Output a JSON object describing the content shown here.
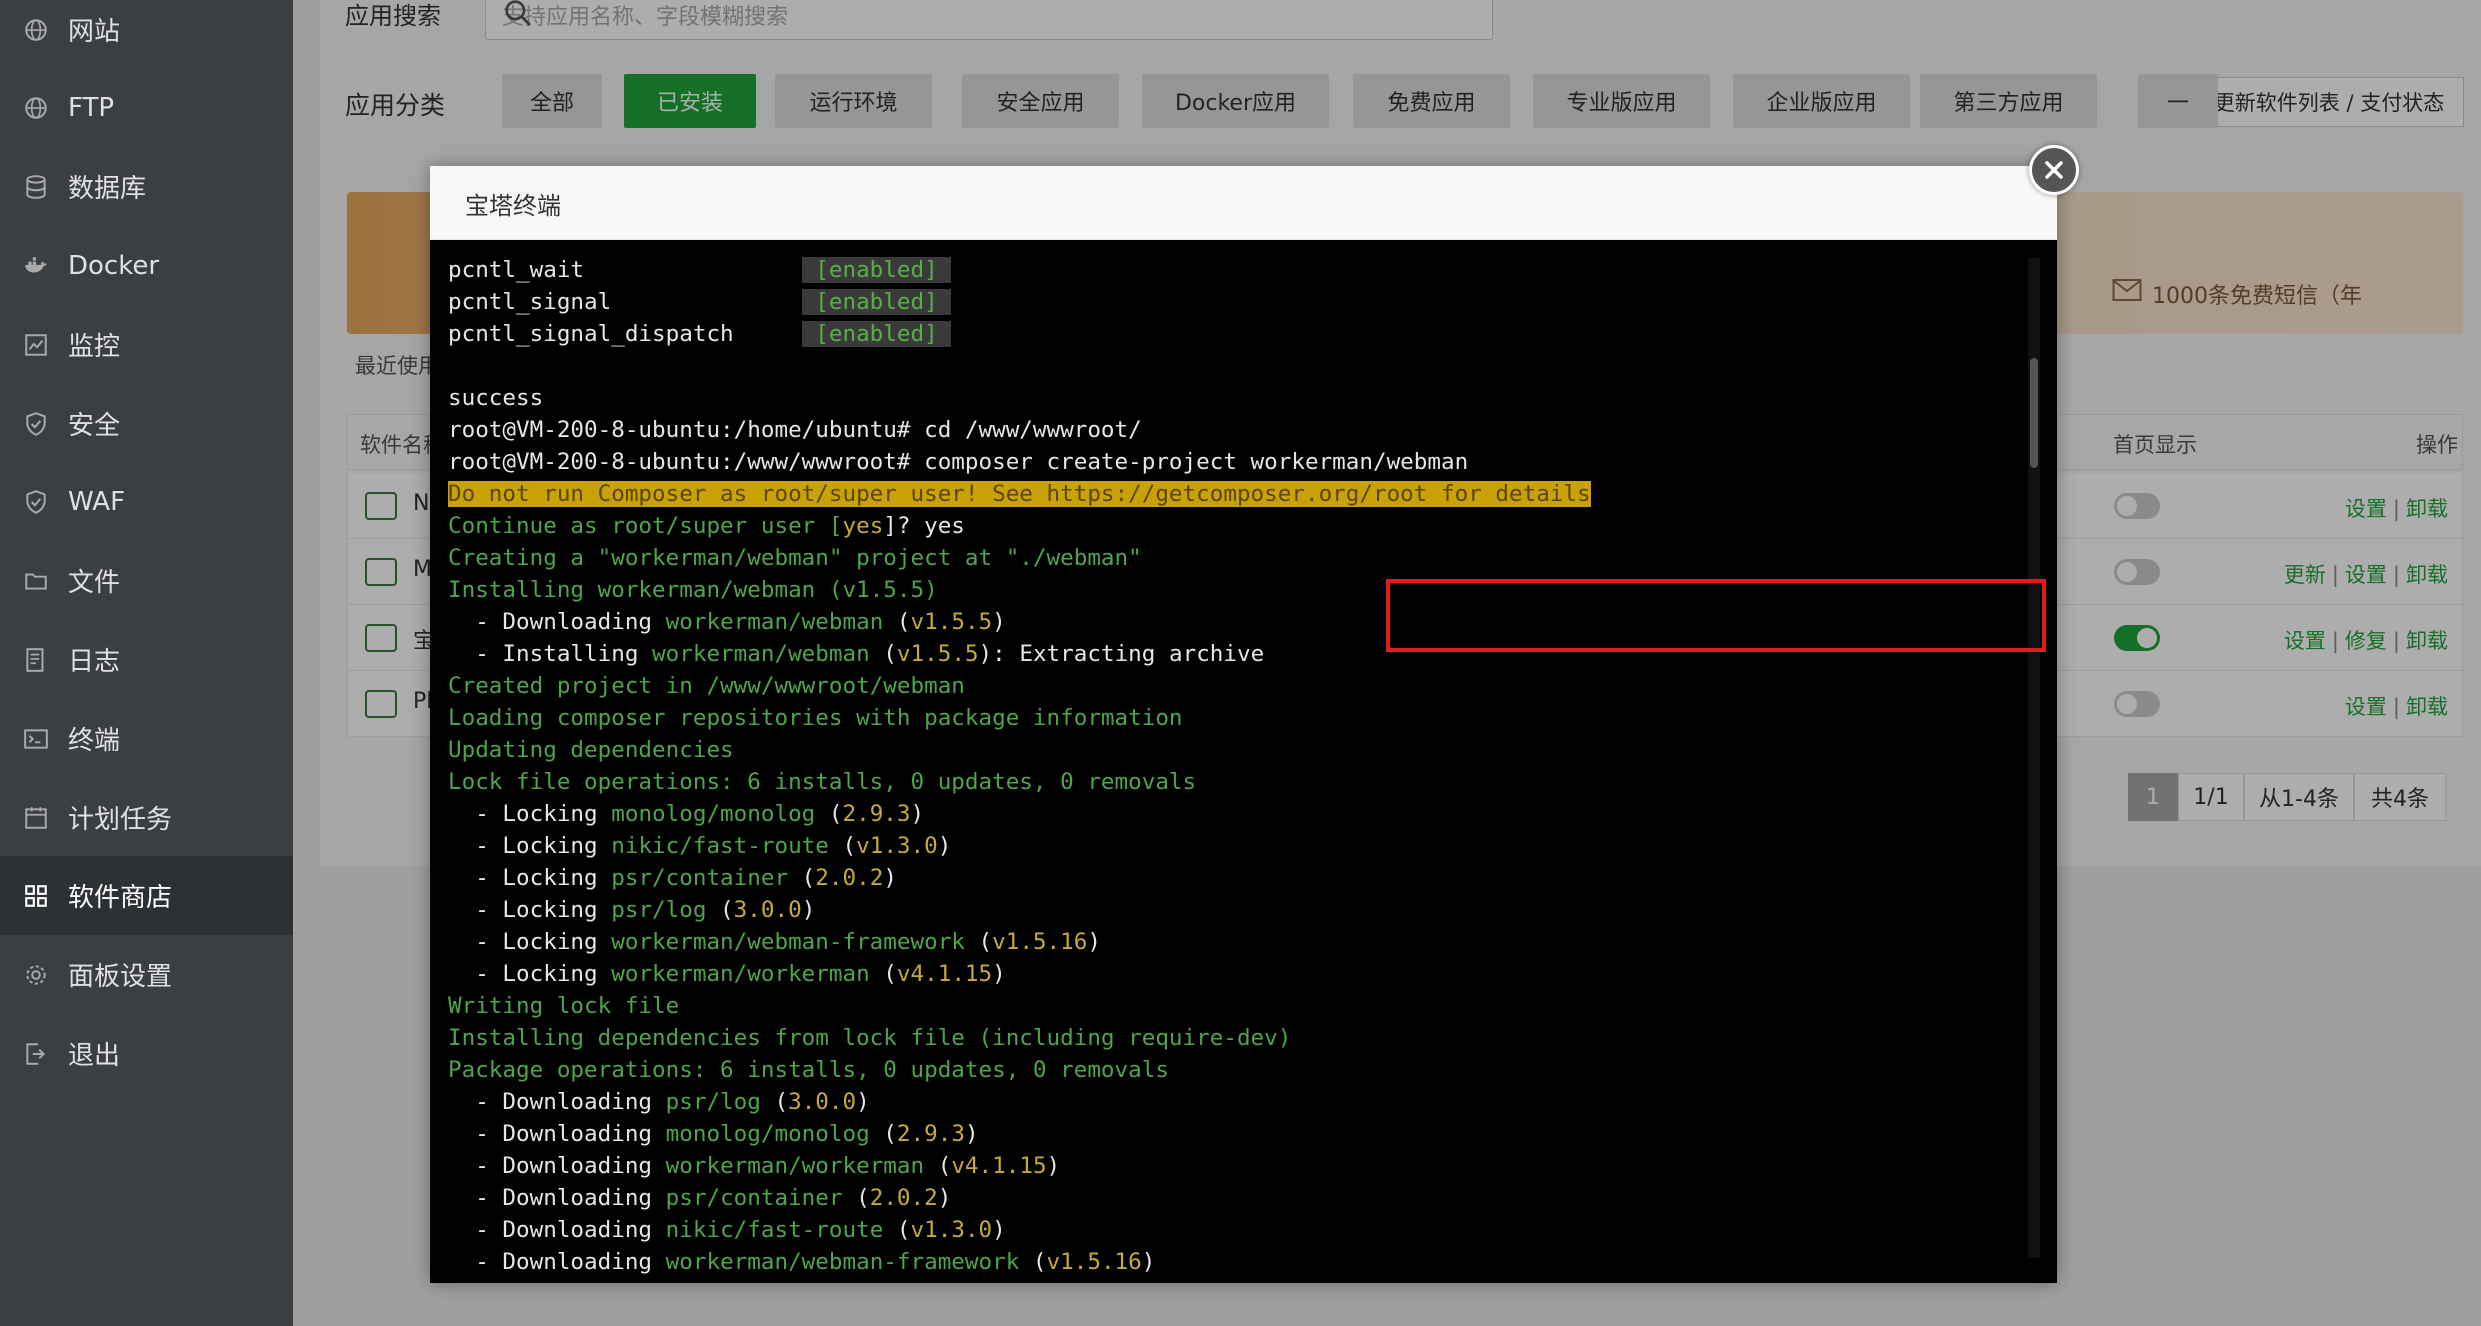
{
  "sidebar": {
    "items": [
      {
        "label": "网站",
        "icon": "globe-icon"
      },
      {
        "label": "FTP",
        "icon": "globe-icon"
      },
      {
        "label": "数据库",
        "icon": "database-icon"
      },
      {
        "label": "Docker",
        "icon": "docker-icon"
      },
      {
        "label": "监控",
        "icon": "monitor-icon"
      },
      {
        "label": "安全",
        "icon": "shield-icon"
      },
      {
        "label": "WAF",
        "icon": "shield-icon"
      },
      {
        "label": "文件",
        "icon": "folder-icon"
      },
      {
        "label": "日志",
        "icon": "log-icon"
      },
      {
        "label": "终端",
        "icon": "terminal-icon"
      },
      {
        "label": "计划任务",
        "icon": "calendar-icon"
      },
      {
        "label": "软件商店",
        "icon": "grid-icon"
      },
      {
        "label": "面板设置",
        "icon": "gear-icon"
      },
      {
        "label": "退出",
        "icon": "logout-icon"
      }
    ]
  },
  "search": {
    "label": "应用搜索",
    "placeholder": "支持应用名称、字段模糊搜索"
  },
  "categories": {
    "label": "应用分类",
    "items": [
      "全部",
      "已安装",
      "运行环境",
      "安全应用",
      "Docker应用",
      "免费应用",
      "专业版应用",
      "企业版应用",
      "第三方应用",
      "一"
    ],
    "update_button": "更新软件列表 / 支付状态"
  },
  "banner": {
    "sms_text": "1000条免费短信（年",
    "recent_label": "最近使用"
  },
  "table": {
    "name_header": "软件名称",
    "home_header": "首页显示",
    "ops_header": "操作",
    "rows": [
      {
        "name": "N",
        "actions": [
          "设置",
          "卸载"
        ]
      },
      {
        "name": "M",
        "actions": [
          "更新",
          "设置",
          "卸载"
        ]
      },
      {
        "name": "宝",
        "actions": [
          "设置",
          "修复",
          "卸载"
        ]
      },
      {
        "name": "Pl",
        "actions": [
          "设置",
          "卸载"
        ]
      }
    ]
  },
  "pagination": {
    "current": "1",
    "pages": "1/1",
    "range": "从1-4条",
    "total": "共4条"
  },
  "dialog": {
    "title": "宝塔终端"
  },
  "terminal": {
    "lines": [
      [
        {
          "t": "pcntl_wait                ",
          "c": "w"
        },
        {
          "t": " [enabled] ",
          "c": "en"
        }
      ],
      [
        {
          "t": "pcntl_signal              ",
          "c": "w"
        },
        {
          "t": " [enabled] ",
          "c": "en"
        }
      ],
      [
        {
          "t": "pcntl_signal_dispatch     ",
          "c": "w"
        },
        {
          "t": " [enabled] ",
          "c": "en"
        }
      ],
      [],
      [
        {
          "t": "success",
          "c": "w"
        }
      ],
      [
        {
          "t": "root@VM-200-8-ubuntu:/home/ubuntu# cd /www/wwwroot/",
          "c": "w"
        }
      ],
      [
        {
          "t": "root@VM-200-8-ubuntu:/www/wwwroot# composer create-project workerman/webman",
          "c": "w"
        }
      ],
      [
        {
          "t": "Do not run Composer as root/super user! See https://getcomposer.org/root for details",
          "c": "warn"
        }
      ],
      [
        {
          "t": "Continue as root/super user [",
          "c": "g"
        },
        {
          "t": "yes",
          "c": "y"
        },
        {
          "t": "]? yes",
          "c": "w"
        }
      ],
      [
        {
          "t": "Creating a \"workerman/webman\" project at \"./webman\"",
          "c": "g"
        }
      ],
      [
        {
          "t": "Installing workerman/webman (v1.5.5)",
          "c": "g"
        }
      ],
      [
        {
          "t": "  - Downloading ",
          "c": "w"
        },
        {
          "t": "workerman/webman",
          "c": "g"
        },
        {
          "t": " (",
          "c": "w"
        },
        {
          "t": "v1.5.5",
          "c": "y"
        },
        {
          "t": ")",
          "c": "w"
        }
      ],
      [
        {
          "t": "  - Installing ",
          "c": "w"
        },
        {
          "t": "workerman/webman",
          "c": "g"
        },
        {
          "t": " (",
          "c": "w"
        },
        {
          "t": "v1.5.5",
          "c": "y"
        },
        {
          "t": "): Extracting archive",
          "c": "w"
        }
      ],
      [
        {
          "t": "Created project in /www/wwwroot/webman",
          "c": "g"
        }
      ],
      [
        {
          "t": "Loading composer repositories with package information",
          "c": "g"
        }
      ],
      [
        {
          "t": "Updating dependencies",
          "c": "g"
        }
      ],
      [
        {
          "t": "Lock file operations: 6 installs, 0 updates, 0 removals",
          "c": "g"
        }
      ],
      [
        {
          "t": "  - Locking ",
          "c": "w"
        },
        {
          "t": "monolog/monolog",
          "c": "g"
        },
        {
          "t": " (",
          "c": "w"
        },
        {
          "t": "2.9.3",
          "c": "y"
        },
        {
          "t": ")",
          "c": "w"
        }
      ],
      [
        {
          "t": "  - Locking ",
          "c": "w"
        },
        {
          "t": "nikic/fast-route",
          "c": "g"
        },
        {
          "t": " (",
          "c": "w"
        },
        {
          "t": "v1.3.0",
          "c": "y"
        },
        {
          "t": ")",
          "c": "w"
        }
      ],
      [
        {
          "t": "  - Locking ",
          "c": "w"
        },
        {
          "t": "psr/container",
          "c": "g"
        },
        {
          "t": " (",
          "c": "w"
        },
        {
          "t": "2.0.2",
          "c": "y"
        },
        {
          "t": ")",
          "c": "w"
        }
      ],
      [
        {
          "t": "  - Locking ",
          "c": "w"
        },
        {
          "t": "psr/log",
          "c": "g"
        },
        {
          "t": " (",
          "c": "w"
        },
        {
          "t": "3.0.0",
          "c": "y"
        },
        {
          "t": ")",
          "c": "w"
        }
      ],
      [
        {
          "t": "  - Locking ",
          "c": "w"
        },
        {
          "t": "workerman/webman-framework",
          "c": "g"
        },
        {
          "t": " (",
          "c": "w"
        },
        {
          "t": "v1.5.16",
          "c": "y"
        },
        {
          "t": ")",
          "c": "w"
        }
      ],
      [
        {
          "t": "  - Locking ",
          "c": "w"
        },
        {
          "t": "workerman/workerman",
          "c": "g"
        },
        {
          "t": " (",
          "c": "w"
        },
        {
          "t": "v4.1.15",
          "c": "y"
        },
        {
          "t": ")",
          "c": "w"
        }
      ],
      [
        {
          "t": "Writing lock file",
          "c": "g"
        }
      ],
      [
        {
          "t": "Installing dependencies from lock file (including require-dev)",
          "c": "g"
        }
      ],
      [
        {
          "t": "Package operations: 6 installs, 0 updates, 0 removals",
          "c": "g"
        }
      ],
      [
        {
          "t": "  - Downloading ",
          "c": "w"
        },
        {
          "t": "psr/log",
          "c": "g"
        },
        {
          "t": " (",
          "c": "w"
        },
        {
          "t": "3.0.0",
          "c": "y"
        },
        {
          "t": ")",
          "c": "w"
        }
      ],
      [
        {
          "t": "  - Downloading ",
          "c": "w"
        },
        {
          "t": "monolog/monolog",
          "c": "g"
        },
        {
          "t": " (",
          "c": "w"
        },
        {
          "t": "2.9.3",
          "c": "y"
        },
        {
          "t": ")",
          "c": "w"
        }
      ],
      [
        {
          "t": "  - Downloading ",
          "c": "w"
        },
        {
          "t": "workerman/workerman",
          "c": "g"
        },
        {
          "t": " (",
          "c": "w"
        },
        {
          "t": "v4.1.15",
          "c": "y"
        },
        {
          "t": ")",
          "c": "w"
        }
      ],
      [
        {
          "t": "  - Downloading ",
          "c": "w"
        },
        {
          "t": "psr/container",
          "c": "g"
        },
        {
          "t": " (",
          "c": "w"
        },
        {
          "t": "2.0.2",
          "c": "y"
        },
        {
          "t": ")",
          "c": "w"
        }
      ],
      [
        {
          "t": "  - Downloading ",
          "c": "w"
        },
        {
          "t": "nikic/fast-route",
          "c": "g"
        },
        {
          "t": " (",
          "c": "w"
        },
        {
          "t": "v1.3.0",
          "c": "y"
        },
        {
          "t": ")",
          "c": "w"
        }
      ],
      [
        {
          "t": "  - Downloading ",
          "c": "w"
        },
        {
          "t": "workerman/webman-framework",
          "c": "g"
        },
        {
          "t": " (",
          "c": "w"
        },
        {
          "t": "v1.5.16",
          "c": "y"
        },
        {
          "t": ")",
          "c": "w"
        }
      ]
    ]
  },
  "colors": {
    "accent": "#20a53a",
    "sidebar": "#3b3f44",
    "highlight": "#e11b1b",
    "warning_bg": "#c9a207"
  }
}
